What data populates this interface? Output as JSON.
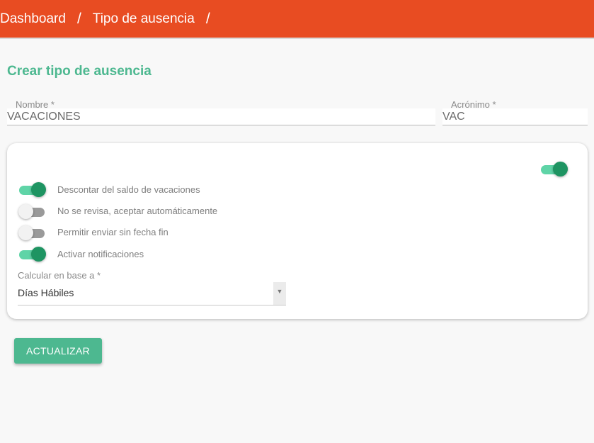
{
  "breadcrumb": {
    "items": [
      "Dashboard",
      "Tipo de ausencia"
    ],
    "separator": "/"
  },
  "page": {
    "title": "Crear tipo de ausencia"
  },
  "form": {
    "name": {
      "label": "Nombre *",
      "value": "VACACIONES"
    },
    "acronym": {
      "label": "Acrónimo *",
      "value": "VAC"
    }
  },
  "options": {
    "header_toggle": {
      "on": true
    },
    "toggles": [
      {
        "label": "Descontar del saldo de vacaciones",
        "on": true
      },
      {
        "label": "No se revisa, aceptar automáticamente",
        "on": false
      },
      {
        "label": "Permitir enviar sin fecha fin",
        "on": false
      },
      {
        "label": "Activar notificaciones",
        "on": true
      }
    ],
    "calculation": {
      "label": "Calcular en base a *",
      "selected": "Días Hábiles",
      "arrow_icon": "triangle-down-icon"
    }
  },
  "actions": {
    "update_label": "ACTUALIZAR"
  },
  "colors": {
    "topbar": "#e84c22",
    "accent": "#4db890",
    "toggle_on_track": "#5fd4a7",
    "toggle_on_thumb": "#1e9462",
    "toggle_off_track": "#9a9a9a"
  }
}
